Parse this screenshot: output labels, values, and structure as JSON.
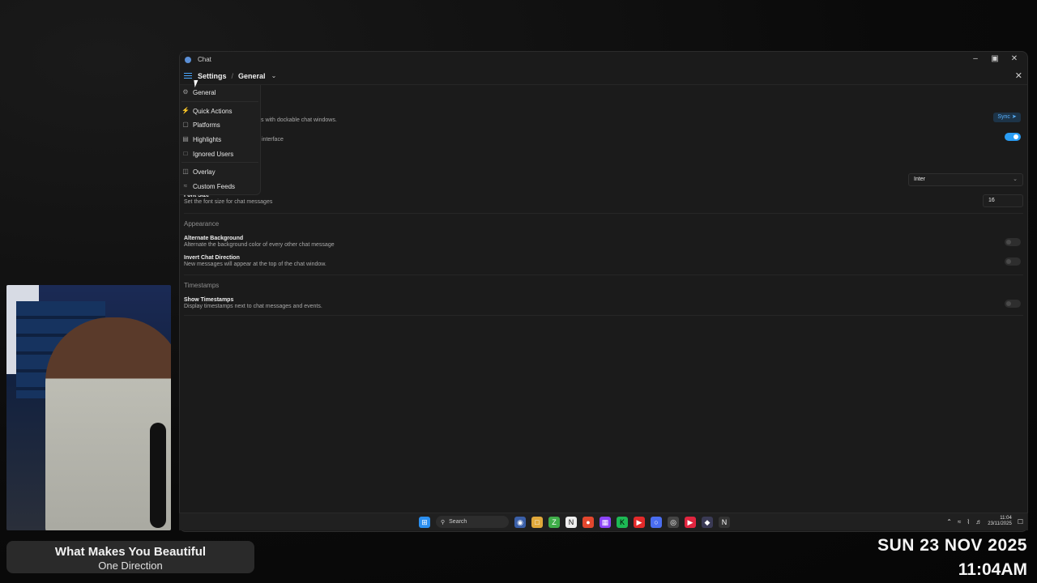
{
  "window": {
    "title": "Chat"
  },
  "breadcrumb": {
    "root": "Settings",
    "separator": "/",
    "current": "General"
  },
  "menu": {
    "items": [
      {
        "label": "General",
        "icon": "gear-icon"
      },
      {
        "label": "Quick Actions",
        "icon": "bolt-icon"
      },
      {
        "label": "Platforms",
        "icon": "monitor-icon"
      },
      {
        "label": "Highlights",
        "icon": "highlight-icon"
      },
      {
        "label": "Ignored Users",
        "icon": "user-block-icon"
      },
      {
        "label": "Overlay",
        "icon": "overlay-icon"
      },
      {
        "label": "Custom Feeds",
        "icon": "rss-icon"
      }
    ]
  },
  "settings": {
    "dock_desc_partial": "s with dockable chat windows.",
    "interface_desc_partial": "interface",
    "sync_label": "Sync",
    "dock_toggle_on": true,
    "font_select_value": "Inter",
    "font_size": {
      "label": "Font Size",
      "desc": "Set the font size for chat messages",
      "value": "16"
    },
    "appearance": {
      "heading": "Appearance",
      "alternate": {
        "label": "Alternate Background",
        "desc": "Alternate the background color of every other chat message",
        "on": false
      },
      "invert": {
        "label": "Invert Chat Direction",
        "desc": "New messages will appear at the top of the chat window.",
        "on": false
      }
    },
    "timestamps": {
      "heading": "Timestamps",
      "show": {
        "label": "Show Timestamps",
        "desc": "Display timestamps next to chat messages and events.",
        "on": false
      }
    }
  },
  "taskbar": {
    "search_label": "Search",
    "time": "11:04",
    "date": "23/11/2025"
  },
  "overlay": {
    "song_title": "What Makes You Beautiful",
    "song_artist": "One Direction",
    "clock_date": "SUN 23 NOV 2025",
    "clock_time": "11:04AM"
  },
  "colors": {
    "accent": "#2a9df4",
    "window_bg": "#1b1b1b",
    "menu_bg": "#1f1f1f"
  }
}
